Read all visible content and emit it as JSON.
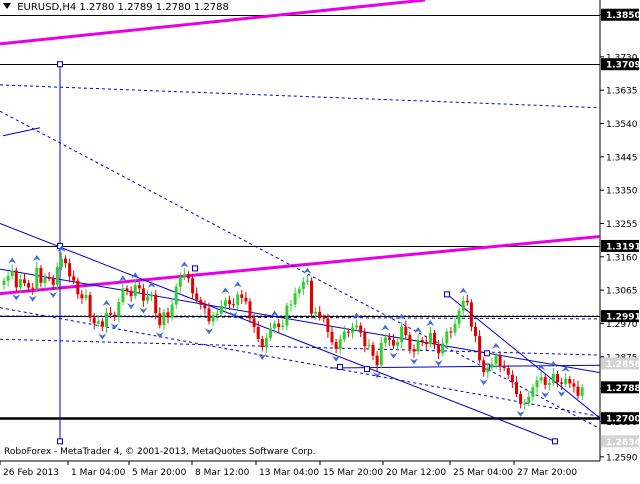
{
  "header": {
    "symbol": "EURUSD,H4",
    "ohlc": "1.2780 1.2789 1.2780 1.2788"
  },
  "footer": {
    "copyright": "RoboForex - MetaTrader 4, © 2001-2013, MetaQuotes Software Corp."
  },
  "colors": {
    "background": "#ffffff",
    "bull_candle": "#32cd32",
    "bear_candle": "#e00000",
    "trend_line": "#0000cd",
    "channel_line": "#e600e6",
    "level_line": "#000000",
    "fractal_arrow": "#4169e1",
    "current_price_label": "#ffffff"
  },
  "chart_data": {
    "type": "candlestick",
    "symbol": "EURUSD",
    "timeframe": "H4",
    "y_ticks": [
      "1.3850",
      "1.3730",
      "1.3635",
      "1.3540",
      "1.3445",
      "1.3350",
      "1.3255",
      "1.3160",
      "1.3065",
      "1.2970",
      "1.2875",
      "1.2785",
      "1.2690",
      "1.2590"
    ],
    "y_range": [
      1.2578,
      1.3892
    ],
    "x_ticks": [
      "26 Feb 2013",
      "1 Mar 04:00",
      "5 Mar 20:00",
      "8 Mar 12:00",
      "13 Mar 04:00",
      "15 Mar 20:00",
      "20 Mar 12:00",
      "25 Mar 04:00",
      "27 Mar 20:00"
    ],
    "horizontal_levels": [
      {
        "label": "1.3850",
        "value": 1.385
      },
      {
        "label": "1.3709",
        "value": 1.3709
      },
      {
        "label": "1.3191",
        "value": 1.3191
      },
      {
        "label": "1.2991",
        "value": 1.2991
      },
      {
        "label": "1.2700",
        "value": 1.27
      }
    ],
    "price_labels": [
      {
        "label": "1.2856",
        "value": 1.2856,
        "style": "light"
      },
      {
        "label": "1.2788",
        "value": 1.2788,
        "style": "current"
      },
      {
        "label": "1.2634",
        "value": 1.2634,
        "style": "light"
      }
    ],
    "closes": [
      1.3092,
      1.3105,
      1.3121,
      1.3073,
      1.3096,
      1.3085,
      1.3072,
      1.3069,
      1.3128,
      1.3086,
      1.31,
      1.3099,
      1.308,
      1.3131,
      1.3155,
      1.3142,
      1.3104,
      1.3092,
      1.3053,
      1.3042,
      1.3051,
      1.2987,
      1.297,
      1.2976,
      1.2961,
      1.3,
      1.2995,
      1.299,
      1.3031,
      1.307,
      1.3063,
      1.3048,
      1.3079,
      1.307,
      1.3035,
      1.3047,
      1.3052,
      1.2999,
      1.2965,
      1.3002,
      1.2987,
      1.3024,
      1.3075,
      1.3103,
      1.311,
      1.3099,
      1.3056,
      1.3037,
      1.3023,
      1.3013,
      1.2976,
      1.2994,
      1.2998,
      1.302,
      1.3036,
      1.3025,
      1.3023,
      1.3053,
      1.3043,
      1.3033,
      1.2984,
      1.296,
      1.2926,
      1.2903,
      1.2929,
      1.2956,
      1.297,
      1.296,
      1.2964,
      1.3021,
      1.3024,
      1.3056,
      1.3068,
      1.3089,
      1.3092,
      1.2998,
      1.3003,
      1.2987,
      1.2985,
      1.2946,
      1.2917,
      1.2898,
      1.2925,
      1.2947,
      1.2944,
      1.2959,
      1.2964,
      1.2944,
      1.2905,
      1.2909,
      1.2878,
      1.2851,
      1.2915,
      1.293,
      1.2923,
      1.2907,
      1.2917,
      1.2961,
      1.2937,
      1.2897,
      1.289,
      1.2923,
      1.2918,
      1.2911,
      1.2943,
      1.291,
      1.2885,
      1.2913,
      1.2947,
      1.2944,
      1.2969,
      1.3007,
      1.3035,
      1.303,
      1.2961,
      1.2934,
      1.2865,
      1.2831,
      1.2844,
      1.2855,
      1.2878,
      1.2848,
      1.2843,
      1.2824,
      1.2803,
      1.2769,
      1.2741,
      1.2742,
      1.2761,
      1.2788,
      1.2808,
      1.2817,
      1.2795,
      1.28,
      1.2826,
      1.2802,
      1.2798,
      1.2812,
      1.2799,
      1.279,
      1.2764,
      1.2788
    ],
    "trend_lines": [
      {
        "color": "channel",
        "from": [
          "26 Feb 2013",
          1.3055
        ],
        "to": [
          "right-edge",
          1.3218
        ]
      },
      {
        "color": "channel",
        "from": [
          "26 Feb 2013",
          1.3767
        ],
        "to": [
          "top-edge",
          1.3892
        ]
      },
      {
        "color": "trend",
        "from": [
          "26 Feb 2013",
          1.3255
        ],
        "to": [
          "28 Mar",
          1.2634
        ]
      },
      {
        "color": "trend",
        "from": [
          "26 Feb 2013",
          1.3125
        ],
        "to": [
          "27 Mar 20:00",
          1.2855
        ]
      },
      {
        "color": "trend",
        "from": [
          "15 Mar 20:00",
          1.2843
        ],
        "to": [
          "28 Mar",
          1.2851
        ]
      },
      {
        "color": "trend",
        "from": [
          "25 Mar 04:00",
          1.3058
        ],
        "to": [
          "28 Mar",
          1.27
        ]
      }
    ]
  }
}
